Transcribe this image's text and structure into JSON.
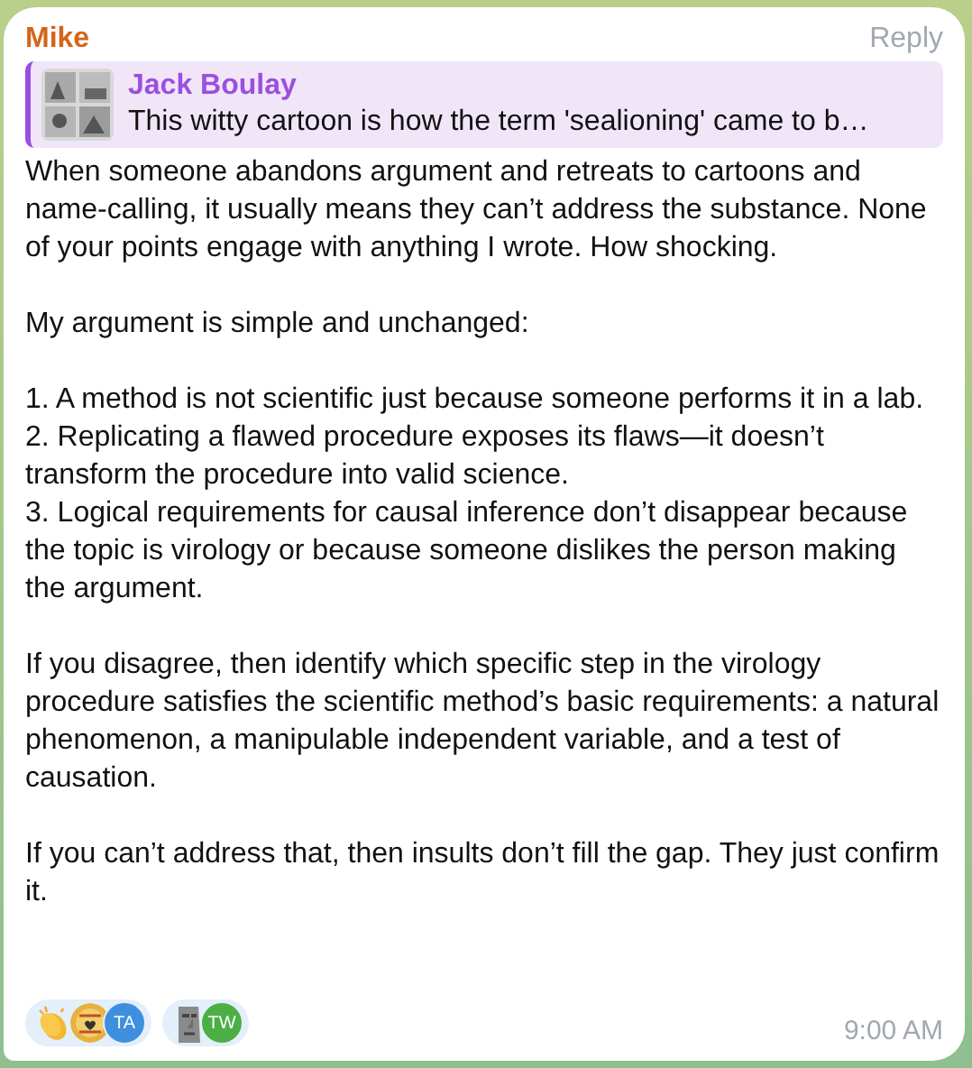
{
  "message": {
    "sender": "Mike",
    "reply_action": "Reply",
    "reply": {
      "author": "Jack Boulay",
      "text": "This witty cartoon is how the term 'sealioning'  came to b…",
      "thumbnail": {
        "kind": "picture"
      }
    },
    "paragraphs": [
      [
        "When someone abandons argument and retreats to cartoons and name-calling, it usually means they can’t address the substance. None of your points engage with anything I wrote. How shocking."
      ],
      [
        "My argument is simple and unchanged:"
      ],
      [
        "1. A method is not scientific just because someone performs it in a lab.",
        "2. Replicating a flawed procedure exposes its flaws—it doesn’t transform the procedure into valid science.",
        "3. Logical requirements for causal inference don’t disappear because the topic is virology or because someone dislikes the person making the argument."
      ],
      [
        "If you disagree, then identify which specific step in the virology procedure satisfies the scientific method’s basic requirements: a natural phenomenon, a manipulable independent variable, and a test of causation."
      ],
      [
        "If you can’t address that, then insults don’t fill the gap. They just confirm it."
      ]
    ],
    "reactions": [
      {
        "kind": "clap",
        "avatars": [
          {
            "kind": "picture"
          },
          {
            "kind": "initials",
            "initials": "TA",
            "color": "#3f8fdf"
          }
        ]
      },
      {
        "kind": "moai",
        "avatars": [
          {
            "kind": "initials",
            "initials": "TW",
            "color": "#4caf45"
          }
        ]
      }
    ],
    "time": "9:00 AM"
  }
}
